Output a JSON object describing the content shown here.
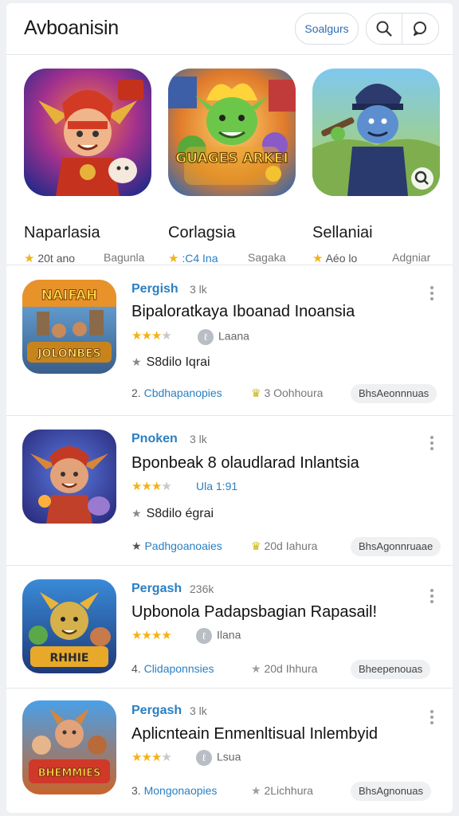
{
  "header": {
    "title": "Avboanisin",
    "pill_label": "Soalgurs",
    "search_icon": "search-icon",
    "chat_icon": "chat-bubble-icon"
  },
  "featured": [
    {
      "name": "Naparlasia",
      "rating": "20t ano",
      "meta": "Bagunla",
      "image_text": ""
    },
    {
      "name": "Corlagsia",
      "rating": ":C4 Ina",
      "meta": "Sagaka",
      "image_text": "GUAGES ARKEI"
    },
    {
      "name": "Sellaniai",
      "rating": "Aéo lo",
      "meta": "Adgniar",
      "image_text": ""
    }
  ],
  "apps": [
    {
      "category": "Pergish",
      "count": "3 lk",
      "title": "Bipaloratkaya Iboanad Inoansia",
      "stars": 3,
      "rating_text": "Laana",
      "line3": "S8dilo Iqrai",
      "rank": "2.",
      "developer": "Cbdhapanopies",
      "downloads": "3 Oohhoura",
      "tag": "BhsAeonnnuas",
      "image_text_top": "NAIFAH",
      "image_text_bottom": "JOLONBES"
    },
    {
      "category": "Pnoken",
      "count": "3 lk",
      "title": "Bponbeak 8 olaudlarad Inlantsia",
      "stars": 3,
      "rating_text": "Ula 1:91",
      "line3": "S8dilo égrai",
      "rank": "",
      "developer": "Padhgoanoaies",
      "downloads": "20d Iahura",
      "tag": "BhsAgonnruaae",
      "image_text_top": "",
      "image_text_bottom": ""
    },
    {
      "category": "Pergash",
      "count": "236k",
      "title": "Upbonola Padapsbagian Rapasail!",
      "stars": 4,
      "rating_text": "Ilana",
      "line3": "",
      "rank": "4.",
      "developer": "Clidaponnsies",
      "downloads": "20d Ihhura",
      "tag": "Bheepenouas",
      "image_text_top": "",
      "image_text_bottom": "RHHIE"
    },
    {
      "category": "Pergash",
      "count": "3 lk",
      "title": "Aplicnteain Enmenltisual Inlembyid",
      "stars": 3,
      "rating_text": "Lsua",
      "line3": "",
      "rank": "3.",
      "developer": "Mongonaopies",
      "downloads": "2Lichhura",
      "tag": "BhsAgnonuas",
      "image_text_top": "",
      "image_text_bottom": "BHEMMIES"
    }
  ],
  "colors": {
    "accent": "#2a7fc2",
    "star": "#f3b21a"
  }
}
